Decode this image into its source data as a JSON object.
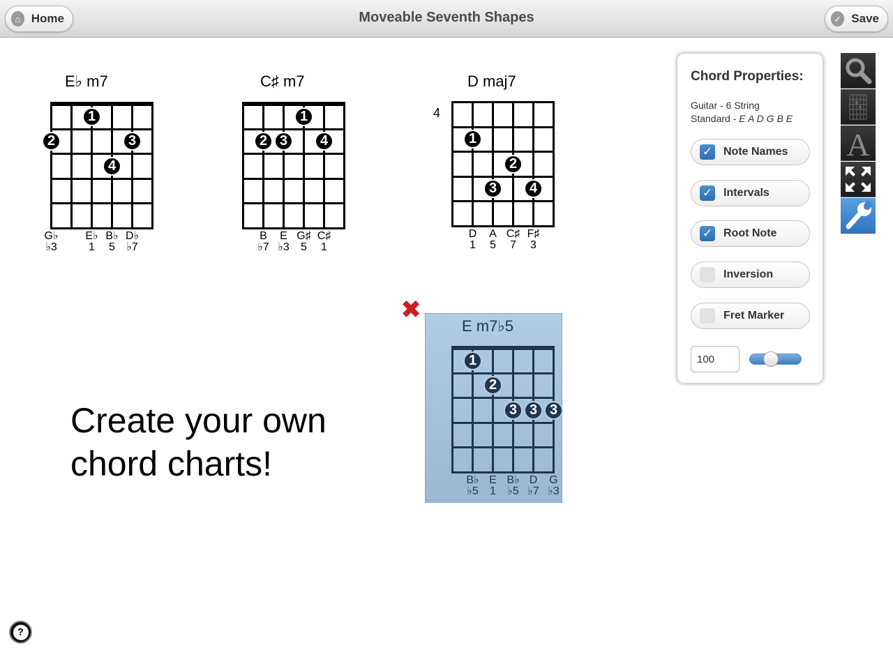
{
  "header": {
    "title": "Moveable Seventh Shapes",
    "home_label": "Home",
    "save_label": "Save"
  },
  "chords": [
    {
      "name": "E♭ m7",
      "fret_start": "",
      "dots": [
        {
          "string": 3,
          "fret": 1,
          "finger": "1"
        },
        {
          "string": 1,
          "fret": 2,
          "finger": "2"
        },
        {
          "string": 5,
          "fret": 2,
          "finger": "3"
        },
        {
          "string": 4,
          "fret": 3,
          "finger": "4"
        }
      ],
      "notes": [
        "G♭",
        "",
        "E♭",
        "B♭",
        "D♭",
        ""
      ],
      "intervals": [
        "♭3",
        "",
        "1",
        "5",
        "♭7",
        ""
      ]
    },
    {
      "name": "C♯ m7",
      "fret_start": "",
      "dots": [
        {
          "string": 4,
          "fret": 1,
          "finger": "1"
        },
        {
          "string": 2,
          "fret": 2,
          "finger": "2"
        },
        {
          "string": 3,
          "fret": 2,
          "finger": "3"
        },
        {
          "string": 5,
          "fret": 2,
          "finger": "4"
        }
      ],
      "notes": [
        "",
        "B",
        "E",
        "G♯",
        "C♯",
        ""
      ],
      "intervals": [
        "",
        "♭7",
        "♭3",
        "5",
        "1",
        ""
      ]
    },
    {
      "name": "D maj7",
      "fret_start": "4",
      "dots": [
        {
          "string": 2,
          "fret": 2,
          "finger": "1"
        },
        {
          "string": 4,
          "fret": 3,
          "finger": "2"
        },
        {
          "string": 3,
          "fret": 4,
          "finger": "3"
        },
        {
          "string": 5,
          "fret": 4,
          "finger": "4"
        }
      ],
      "notes": [
        "",
        "D",
        "A",
        "C♯",
        "F♯",
        ""
      ],
      "intervals": [
        "",
        "1",
        "5",
        "7",
        "3",
        ""
      ]
    },
    {
      "name": "E m7♭5",
      "fret_start": "",
      "selected": true,
      "dots": [
        {
          "string": 2,
          "fret": 1,
          "finger": "1"
        },
        {
          "string": 3,
          "fret": 2,
          "finger": "2"
        },
        {
          "string": 4,
          "fret": 3,
          "finger": "3"
        },
        {
          "string": 5,
          "fret": 3,
          "finger": "3"
        },
        {
          "string": 6,
          "fret": 3,
          "finger": "3"
        }
      ],
      "notes": [
        "",
        "B♭",
        "E",
        "B♭",
        "D",
        "G"
      ],
      "intervals": [
        "",
        "♭5",
        "1",
        "♭5",
        "♭7",
        "♭3"
      ]
    }
  ],
  "promo_line1": "Create your own",
  "promo_line2": "chord charts!",
  "panel": {
    "title": "Chord Properties:",
    "instrument": "Guitar - 6 String",
    "tuning_prefix": "Standard - ",
    "tuning": "E A D G B E",
    "toggles": [
      {
        "label": "Note Names",
        "checked": true
      },
      {
        "label": "Intervals",
        "checked": true
      },
      {
        "label": "Root Note",
        "checked": true
      },
      {
        "label": "Inversion",
        "checked": false
      },
      {
        "label": "Fret Marker",
        "checked": false
      }
    ],
    "size_value": "100",
    "size_slider_level": 0.35
  },
  "toolbar": [
    "magnifier-icon",
    "chord-grid-icon",
    "text-font-icon",
    "expand-icon",
    "wrench-icon"
  ],
  "colors": {
    "selected_bg": "#a8c5de",
    "delete_red": "#cc1f1f",
    "accent_blue": "#2f74c0"
  }
}
